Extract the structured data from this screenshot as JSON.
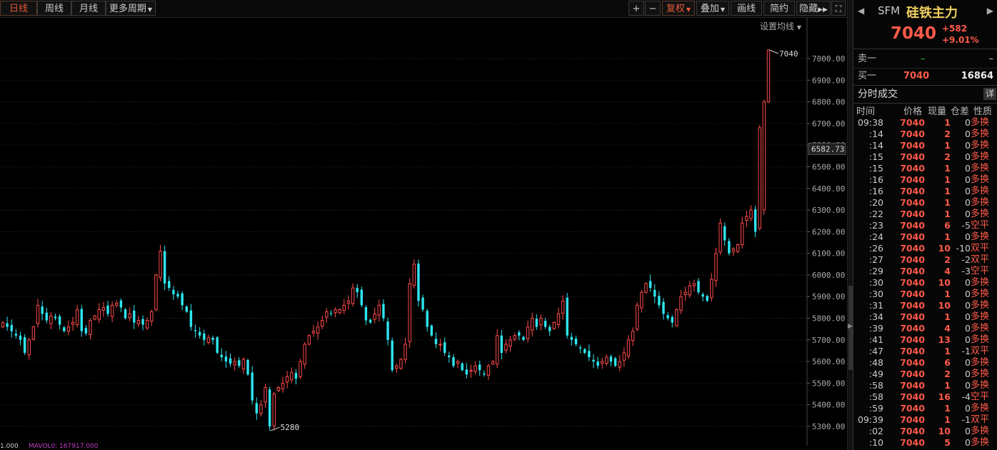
{
  "toolbar": {
    "periods": [
      "日线",
      "周线",
      "月线"
    ],
    "more_period": "更多周期",
    "plus": "+",
    "minus": "−",
    "restore": "复权",
    "overlay": "叠加",
    "btn_kline": "画线",
    "btn_simple": "简约",
    "btn_hide": "隐藏",
    "fullscreen_icon": "expand-icon"
  },
  "settings_label": "设置均线",
  "chart_data": {
    "type": "candlestick",
    "y_ticks": [
      "7000.00",
      "6900.00",
      "6800.00",
      "6700.00",
      "6600.00",
      "6500.00",
      "6400.00",
      "6300.00",
      "6200.00",
      "6100.00",
      "6000.00",
      "5900.00",
      "5800.00",
      "5700.00",
      "5600.00",
      "5500.00",
      "5400.00",
      "5300.00"
    ],
    "ylim": [
      5250,
      7100
    ],
    "high_label": "7040",
    "low_label": "5280",
    "last_price_label": "6582.73",
    "up_color": "#ff4a4a",
    "down_color": "#2ee6f0",
    "closes": [
      5780,
      5760,
      5740,
      5720,
      5700,
      5640,
      5700,
      5760,
      5860,
      5820,
      5790,
      5810,
      5800,
      5770,
      5740,
      5760,
      5780,
      5840,
      5740,
      5730,
      5790,
      5810,
      5840,
      5850,
      5820,
      5860,
      5870,
      5850,
      5800,
      5820,
      5780,
      5790,
      5770,
      5790,
      5830,
      6000,
      6110,
      5960,
      5940,
      5910,
      5900,
      5860,
      5830,
      5760,
      5740,
      5720,
      5700,
      5710,
      5700,
      5640,
      5620,
      5600,
      5590,
      5600,
      5580,
      5610,
      5540,
      5420,
      5360,
      5400,
      5480,
      5300,
      5450,
      5480,
      5500,
      5530,
      5550,
      5520,
      5600,
      5680,
      5720,
      5740,
      5760,
      5790,
      5830,
      5820,
      5840,
      5840,
      5860,
      5880,
      5940,
      5920,
      5860,
      5790,
      5780,
      5820,
      5860,
      5800,
      5700,
      5560,
      5580,
      5610,
      5680,
      5960,
      6050,
      5880,
      5840,
      5760,
      5720,
      5680,
      5680,
      5640,
      5620,
      5580,
      5600,
      5560,
      5540,
      5560,
      5580,
      5560,
      5540,
      5580,
      5600,
      5720,
      5640,
      5680,
      5700,
      5720,
      5720,
      5700,
      5760,
      5800,
      5760,
      5800,
      5760,
      5740,
      5780,
      5820,
      5880,
      5720,
      5700,
      5680,
      5660,
      5640,
      5620,
      5600,
      5580,
      5600,
      5620,
      5600,
      5580,
      5600,
      5640,
      5700,
      5740,
      5860,
      5920,
      5960,
      5940,
      5900,
      5860,
      5820,
      5800,
      5780,
      5840,
      5900,
      5920,
      5950,
      5960,
      5920,
      5900,
      5880,
      5980,
      6100,
      6240,
      6160,
      6100,
      6120,
      6140,
      6240,
      6270,
      6300,
      6200,
      6680,
      6800,
      7040
    ]
  },
  "bottom": {
    "left_text": "1.000",
    "indicator_text": "MAVOL0: 167917.000"
  },
  "quote": {
    "code": "SFM",
    "name": "硅铁主力",
    "price": "7040",
    "change": "+582",
    "change_pct": "+9.01%",
    "sell_label": "卖一",
    "sell_price": "–",
    "sell_vol": "–",
    "buy_label": "买一",
    "buy_price": "7040",
    "buy_vol": "16864"
  },
  "time_trades": {
    "title": "分时成交",
    "detail": "详",
    "headers": [
      "时间",
      "价格",
      "现量",
      "仓差",
      "性质"
    ],
    "rows": [
      [
        "09:38",
        "7040",
        "1",
        "0",
        "多换"
      ],
      [
        ":14",
        "7040",
        "2",
        "0",
        "多换"
      ],
      [
        ":14",
        "7040",
        "1",
        "0",
        "多换"
      ],
      [
        ":15",
        "7040",
        "2",
        "0",
        "多换"
      ],
      [
        ":15",
        "7040",
        "1",
        "0",
        "多换"
      ],
      [
        ":16",
        "7040",
        "1",
        "0",
        "多换"
      ],
      [
        ":16",
        "7040",
        "1",
        "0",
        "多换"
      ],
      [
        ":20",
        "7040",
        "1",
        "0",
        "多换"
      ],
      [
        ":22",
        "7040",
        "1",
        "0",
        "多换"
      ],
      [
        ":23",
        "7040",
        "6",
        "-5",
        "空平"
      ],
      [
        ":24",
        "7040",
        "1",
        "0",
        "多换"
      ],
      [
        ":26",
        "7040",
        "10",
        "-10",
        "双平"
      ],
      [
        ":27",
        "7040",
        "2",
        "-2",
        "双平"
      ],
      [
        ":29",
        "7040",
        "4",
        "-3",
        "空平"
      ],
      [
        ":30",
        "7040",
        "10",
        "0",
        "多换"
      ],
      [
        ":30",
        "7040",
        "1",
        "0",
        "多换"
      ],
      [
        ":31",
        "7040",
        "10",
        "0",
        "多换"
      ],
      [
        ":34",
        "7040",
        "1",
        "0",
        "多换"
      ],
      [
        ":39",
        "7040",
        "4",
        "0",
        "多换"
      ],
      [
        ":41",
        "7040",
        "13",
        "0",
        "多换"
      ],
      [
        ":47",
        "7040",
        "1",
        "-1",
        "双平"
      ],
      [
        ":48",
        "7040",
        "6",
        "0",
        "多换"
      ],
      [
        ":49",
        "7040",
        "2",
        "0",
        "多换"
      ],
      [
        ":58",
        "7040",
        "1",
        "0",
        "多换"
      ],
      [
        ":58",
        "7040",
        "16",
        "-4",
        "空平"
      ],
      [
        ":59",
        "7040",
        "1",
        "0",
        "多换"
      ],
      [
        "09:39",
        "7040",
        "1",
        "-1",
        "双平"
      ],
      [
        ":02",
        "7040",
        "10",
        "0",
        "多换"
      ],
      [
        ":10",
        "7040",
        "5",
        "0",
        "多换"
      ]
    ]
  }
}
